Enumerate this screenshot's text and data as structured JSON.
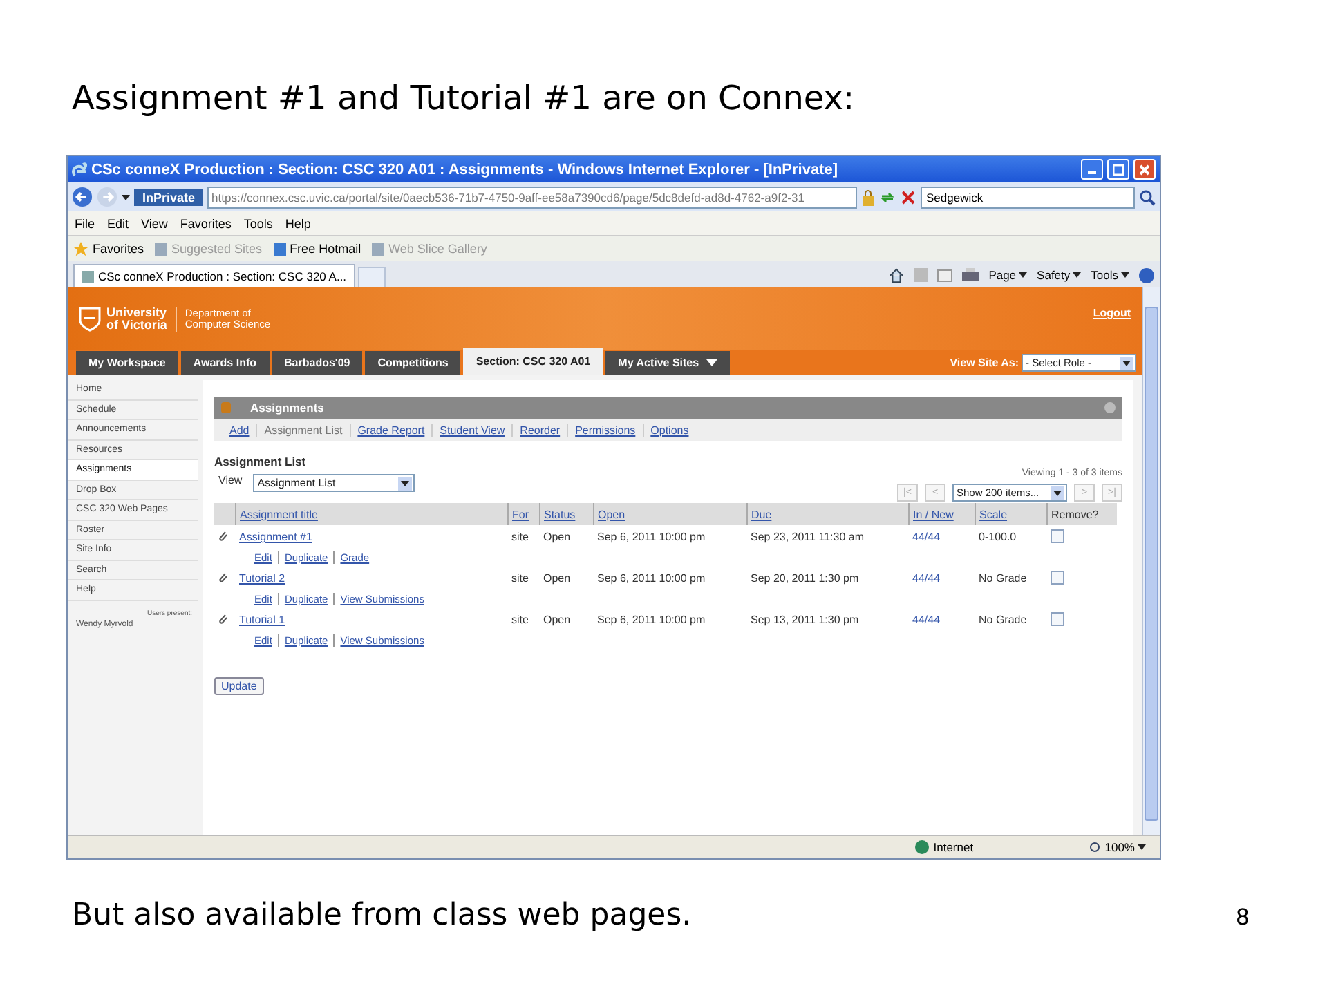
{
  "slide": {
    "title": "Assignment #1 and Tutorial #1 are on Connex:",
    "footer_text": "But also available from class web pages.",
    "page_number": "8"
  },
  "browser": {
    "window_title": "CSc conneX Production : Section: CSC 320 A01 : Assignments - Windows Internet Explorer - [InPrivate]",
    "inprivate_badge": "InPrivate",
    "address_url": "https://connex.csc.uvic.ca/portal/site/0aecb536-71b7-4750-9aff-ee58a7390cd6/page/5dc8defd-ad8d-4762-a9f2-31",
    "search_text": "Sedgewick",
    "menu": [
      "File",
      "Edit",
      "View",
      "Favorites",
      "Tools",
      "Help"
    ],
    "favorites_label": "Favorites",
    "favorites_items": [
      {
        "label": "Suggested Sites",
        "disabled": true
      },
      {
        "label": "Free Hotmail",
        "disabled": false
      },
      {
        "label": "Web Slice Gallery",
        "disabled": true
      }
    ],
    "tab_title": "CSc conneX Production : Section: CSC 320 A...",
    "commands": [
      "Page",
      "Safety",
      "Tools"
    ],
    "status_zone": "Internet",
    "zoom": "100%"
  },
  "site": {
    "logo_lines": [
      "University",
      "of Victoria"
    ],
    "department_lines": [
      "Department of",
      "Computer Science"
    ],
    "logout": "Logout",
    "nav_tabs": [
      {
        "label": "My Workspace",
        "selected": false
      },
      {
        "label": "Awards Info",
        "selected": false
      },
      {
        "label": "Barbados'09",
        "selected": false
      },
      {
        "label": "Competitions",
        "selected": false
      },
      {
        "label": "Section: CSC 320 A01",
        "selected": true
      },
      {
        "label": "My Active Sites",
        "selected": false
      }
    ],
    "view_site_as": "View Site As:",
    "role_select": "- Select Role -"
  },
  "sidebar": {
    "items": [
      {
        "label": "Home",
        "selected": false
      },
      {
        "label": "Schedule",
        "selected": false
      },
      {
        "label": "Announcements",
        "selected": false
      },
      {
        "label": "Resources",
        "selected": false
      },
      {
        "label": "Assignments",
        "selected": true
      },
      {
        "label": "Drop Box",
        "selected": false
      },
      {
        "label": "CSC 320 Web Pages",
        "selected": false
      },
      {
        "label": "Roster",
        "selected": false
      },
      {
        "label": "Site Info",
        "selected": false
      },
      {
        "label": "Search",
        "selected": false
      },
      {
        "label": "Help",
        "selected": false
      }
    ],
    "users_present": "Users present:",
    "users": [
      "Wendy Myrvold"
    ]
  },
  "tool": {
    "title": "Assignments",
    "toolbar": [
      {
        "label": "Add",
        "selected": false
      },
      {
        "label": "Assignment List",
        "selected": true
      },
      {
        "label": "Grade Report",
        "selected": false
      },
      {
        "label": "Student View",
        "selected": false
      },
      {
        "label": "Reorder",
        "selected": false
      },
      {
        "label": "Permissions",
        "selected": false
      },
      {
        "label": "Options",
        "selected": false
      }
    ],
    "heading": "Assignment List",
    "view_label": "View",
    "view_select": "Assignment List",
    "viewing": "Viewing 1 - 3 of 3 items",
    "pager": [
      "|<",
      "<",
      ">",
      ">|"
    ],
    "page_size": "Show 200 items...",
    "table": {
      "columns": [
        "Assignment title",
        "For",
        "Status",
        "Open",
        "Due",
        "In / New",
        "Scale",
        "Remove?"
      ],
      "rows": [
        {
          "title": "Assignment #1",
          "actions": [
            "Edit",
            "Duplicate",
            "Grade"
          ],
          "for": "site",
          "status": "Open",
          "open": "Sep 6, 2011 10:00 pm",
          "due": "Sep 23, 2011 11:30 am",
          "in_new": "44/44",
          "scale": "0-100.0",
          "remove": false
        },
        {
          "title": "Tutorial 2",
          "actions": [
            "Edit",
            "Duplicate",
            "View Submissions"
          ],
          "for": "site",
          "status": "Open",
          "open": "Sep 6, 2011 10:00 pm",
          "due": "Sep 20, 2011 1:30 pm",
          "in_new": "44/44",
          "scale": "No Grade",
          "remove": false
        },
        {
          "title": "Tutorial 1",
          "actions": [
            "Edit",
            "Duplicate",
            "View Submissions"
          ],
          "for": "site",
          "status": "Open",
          "open": "Sep 6, 2011 10:00 pm",
          "due": "Sep 13, 2011 1:30 pm",
          "in_new": "44/44",
          "scale": "No Grade",
          "remove": false
        }
      ]
    },
    "update_button": "Update"
  }
}
